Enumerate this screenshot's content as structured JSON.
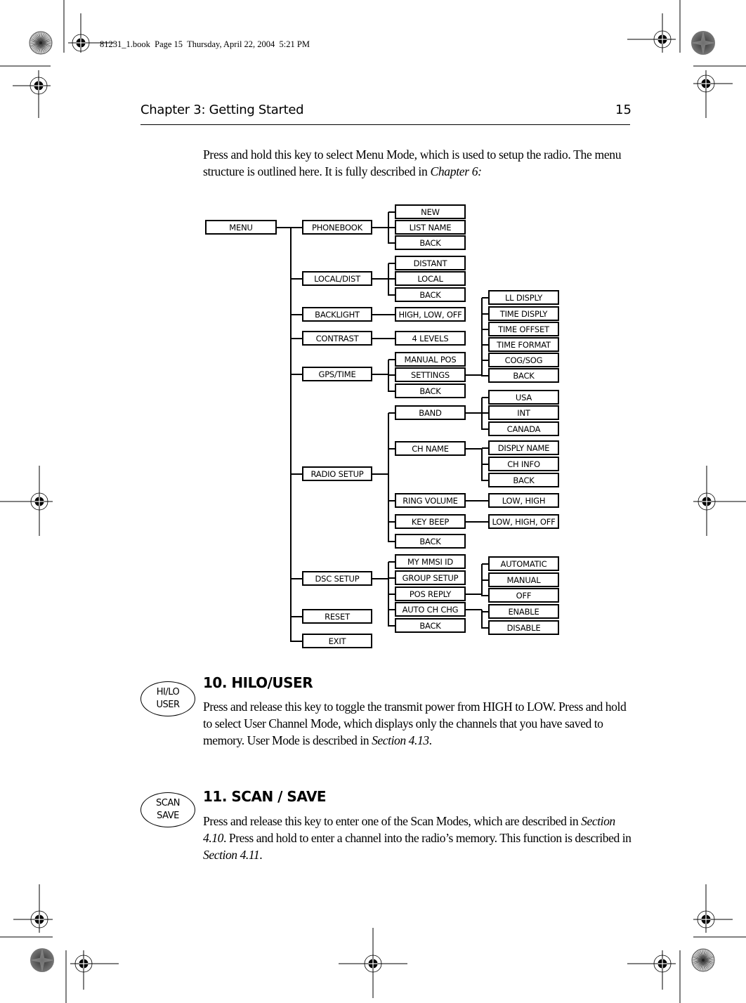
{
  "slug": "81231_1.book  Page 15  Thursday, April 22, 2004  5:21 PM",
  "header": {
    "title": "Chapter 3: Getting Started",
    "page_number": "15"
  },
  "intro": {
    "text": "Press and hold this key to select Menu Mode, which is used to setup the radio. The menu structure is outlined here. It is fully described in ",
    "ref": "Chapter 6:"
  },
  "menu_diagram": {
    "root": "MENU",
    "items": [
      {
        "label": "PHONEBOOK",
        "children": [
          {
            "label": "NEW"
          },
          {
            "label": "LIST NAME"
          },
          {
            "label": "BACK"
          }
        ]
      },
      {
        "label": "LOCAL/DIST",
        "children": [
          {
            "label": "DISTANT"
          },
          {
            "label": "LOCAL"
          },
          {
            "label": "BACK"
          }
        ]
      },
      {
        "label": "BACKLIGHT",
        "children": [
          {
            "label": "HIGH, LOW, OFF"
          }
        ]
      },
      {
        "label": "CONTRAST",
        "children": [
          {
            "label": "4 LEVELS"
          }
        ]
      },
      {
        "label": "GPS/TIME",
        "children": [
          {
            "label": "MANUAL POS"
          },
          {
            "label": "SETTINGS",
            "children": [
              {
                "label": "LL DISPLY"
              },
              {
                "label": "TIME DISPLY"
              },
              {
                "label": "TIME OFFSET"
              },
              {
                "label": "TIME FORMAT"
              },
              {
                "label": "COG/SOG"
              },
              {
                "label": "BACK"
              }
            ]
          },
          {
            "label": "BACK"
          }
        ]
      },
      {
        "label": "RADIO SETUP",
        "children": [
          {
            "label": "BAND",
            "children": [
              {
                "label": "USA"
              },
              {
                "label": "INT"
              },
              {
                "label": "CANADA"
              }
            ]
          },
          {
            "label": "CH NAME",
            "children": [
              {
                "label": "DISPLY NAME"
              },
              {
                "label": "CH INFO"
              },
              {
                "label": "BACK"
              }
            ]
          },
          {
            "label": "RING VOLUME",
            "children": [
              {
                "label": "LOW, HIGH"
              }
            ]
          },
          {
            "label": "KEY BEEP",
            "children": [
              {
                "label": "LOW, HIGH, OFF"
              }
            ]
          },
          {
            "label": "BACK"
          }
        ]
      },
      {
        "label": "DSC SETUP",
        "children": [
          {
            "label": "MY MMSI ID"
          },
          {
            "label": "GROUP SETUP"
          },
          {
            "label": "POS REPLY",
            "children": [
              {
                "label": "AUTOMATIC"
              },
              {
                "label": "MANUAL"
              },
              {
                "label": "OFF"
              }
            ]
          },
          {
            "label": "AUTO CH CHG",
            "children": [
              {
                "label": "ENABLE"
              },
              {
                "label": "DISABLE"
              }
            ]
          },
          {
            "label": "BACK"
          }
        ]
      },
      {
        "label": "RESET"
      },
      {
        "label": "EXIT"
      }
    ]
  },
  "sections": [
    {
      "title": "10. HILO/USER",
      "key_label": [
        "HI/LO",
        "USER"
      ],
      "body_text": "Press and release this key to toggle the transmit power from HIGH to LOW. Press and hold to select User Channel Mode, which displays only the channels that you have saved to memory. User Mode is described in ",
      "body_ref": "Section 4.13",
      "body_end": "."
    },
    {
      "title": "11. SCAN / SAVE",
      "key_label": [
        "SCAN",
        "SAVE"
      ],
      "body_text_1": "Press and release this key to enter one of the Scan Modes, which are described in ",
      "body_ref_1": "Section 4.10",
      "body_text_2": ". Press and hold to enter a channel into the radio’s memory. This function is described in ",
      "body_ref_2": "Section 4.11",
      "body_end": "."
    }
  ]
}
